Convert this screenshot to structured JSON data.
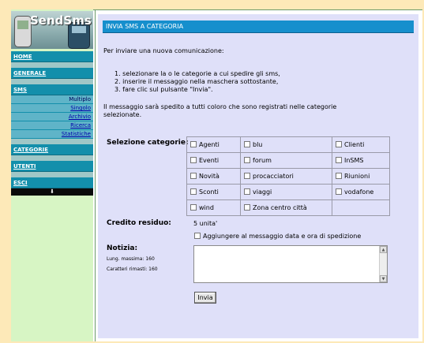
{
  "logo": {
    "text": "SendSms"
  },
  "nav": {
    "items": [
      {
        "label": "HOME"
      },
      {
        "label": "GENERALE"
      },
      {
        "label": "SMS"
      }
    ],
    "sms_sub": [
      "Multiplo",
      "Singolo",
      "Archivio",
      "Ricerca",
      "Statistiche"
    ],
    "items2": [
      {
        "label": "CATEGORIE"
      },
      {
        "label": "UTENTI"
      },
      {
        "label": "ESCI"
      }
    ],
    "bottom_arrow": "⬇"
  },
  "page": {
    "title": "INVIA SMS A CATEGORIA",
    "intro": "Per inviare una nuova comunicazione:",
    "steps": [
      "1.  selezionare la o le categorie a cui spedire gli sms,",
      "2.  inserire il messaggio nella maschera sottostante,",
      "3.  fare clic sul pulsante \"Invia\"."
    ],
    "notice": "Il messaggio sarà spedito a tutti coloro che sono registrati nelle categorie selezionate.",
    "categories_label": "Selezione categorie:",
    "categories": [
      [
        "Agenti",
        "blu",
        "Clienti"
      ],
      [
        "Eventi",
        "forum",
        "InSMS"
      ],
      [
        "Novità",
        "procacciatori",
        "Riunioni"
      ],
      [
        "Sconti",
        "viaggi",
        "vodafone"
      ],
      [
        "wind",
        "Zona centro città",
        ""
      ]
    ],
    "credit_label": "Credito residuo:",
    "credit_value": "5 unita'",
    "append_label": "Aggiungere al messaggio data e ora di spedizione",
    "notice_label": "Notizia:",
    "max_len": "Lung. massima: 160",
    "remaining": "Caratteri rimasti: 160",
    "message_value": "",
    "send_label": "Invia"
  }
}
